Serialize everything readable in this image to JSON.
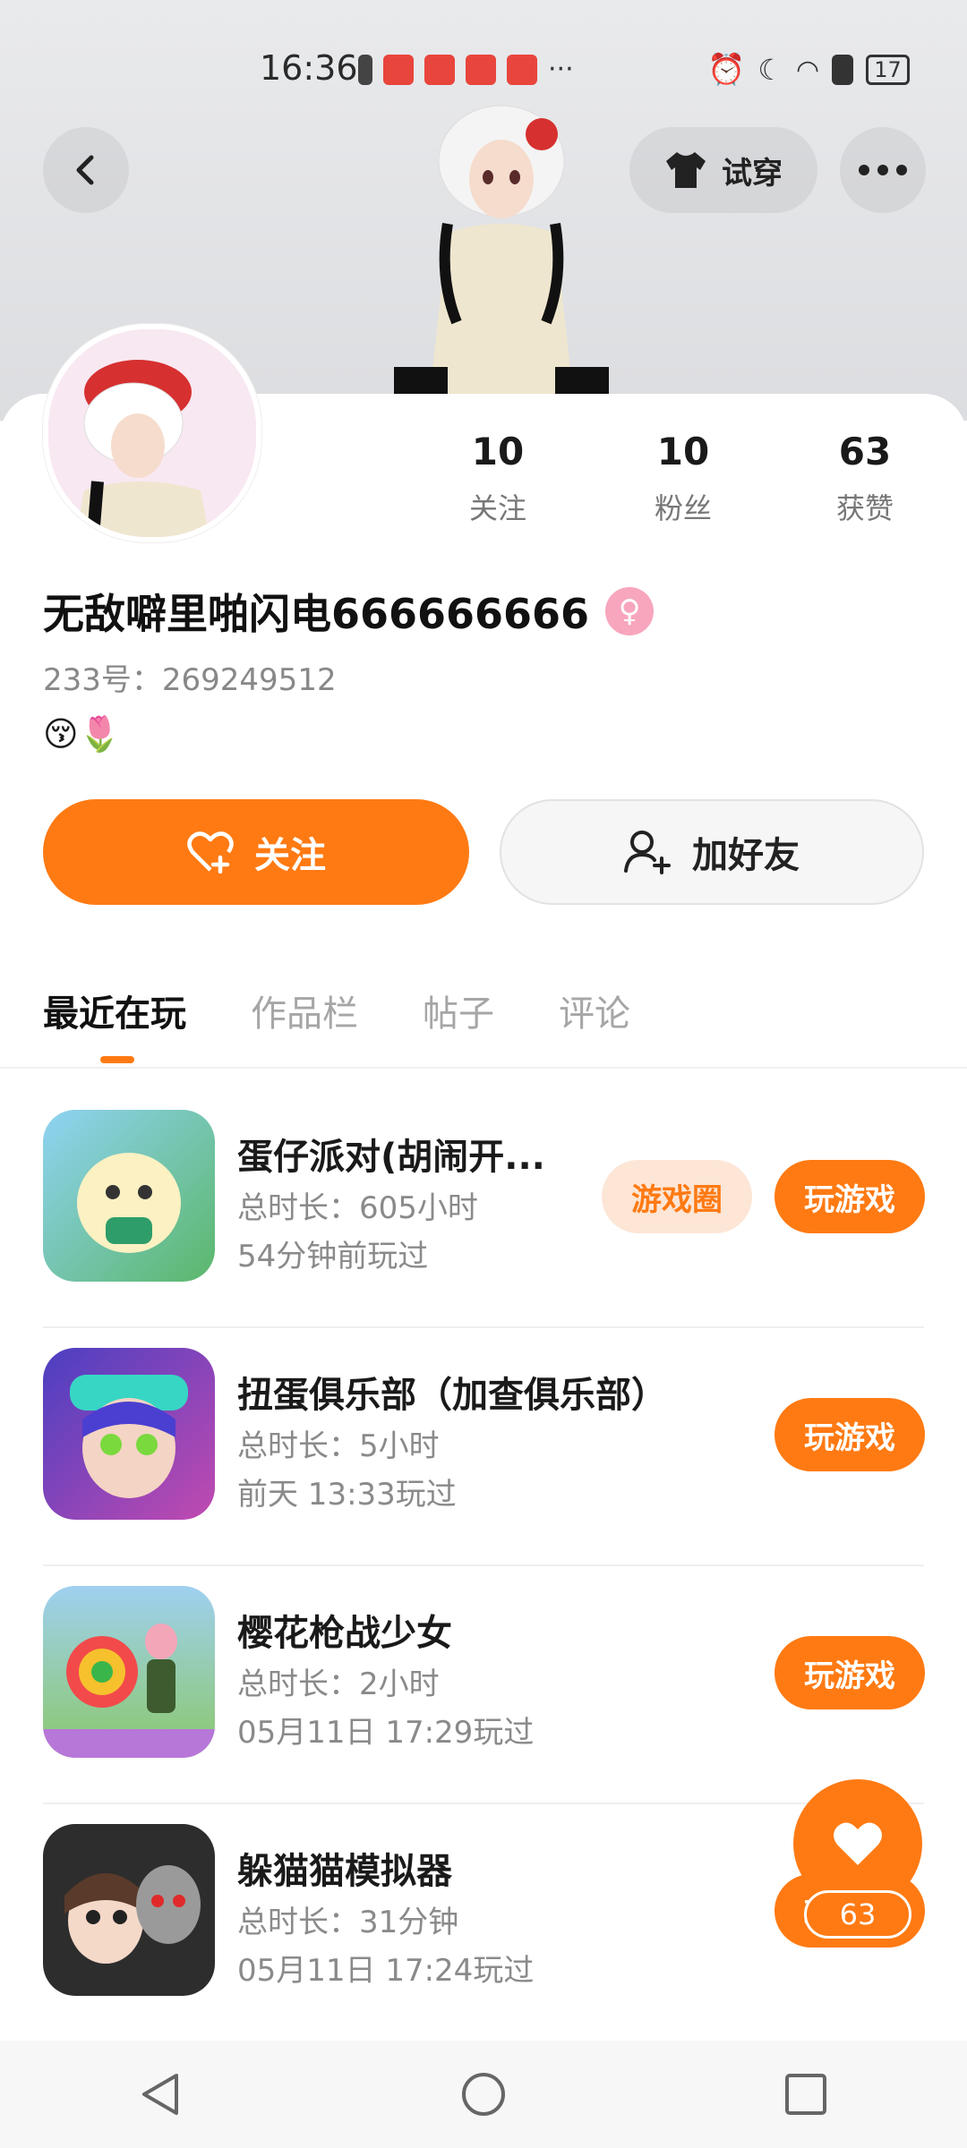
{
  "status_bar": {
    "time": "16:36",
    "battery": "17"
  },
  "header": {
    "try_on_label": "试穿"
  },
  "profile": {
    "stats": [
      {
        "value": "10",
        "label": "关注"
      },
      {
        "value": "10",
        "label": "粉丝"
      },
      {
        "value": "63",
        "label": "获赞"
      }
    ],
    "username": "无敌噼里啪闪电666666666",
    "uid": "233号：269249512",
    "bio_emoji": "😚🌷",
    "follow_label": "关注",
    "add_friend_label": "加好友"
  },
  "tabs": [
    "最近在玩",
    "作品栏",
    "帖子",
    "评论"
  ],
  "games": [
    {
      "title": "蛋仔派对(胡闹开...",
      "duration": "总时长：605小时",
      "last_played": "54分钟前玩过",
      "circle_label": "游戏圈",
      "play_label": "玩游戏",
      "icon_color": "#8fd3f4"
    },
    {
      "title": "扭蛋俱乐部（加查俱乐部）",
      "duration": "总时长：5小时",
      "last_played": "前天 13:33玩过",
      "play_label": "玩游戏",
      "icon_color": "#6c4ad1"
    },
    {
      "title": "樱花枪战少女",
      "duration": "总时长：2小时",
      "last_played": "05月11日 17:29玩过",
      "play_label": "玩游戏",
      "icon_color": "#9bd36a"
    },
    {
      "title": "躲猫猫模拟器",
      "duration": "总时长：31分钟",
      "last_played": "05月11日 17:24玩过",
      "play_label": "玩游戏",
      "icon_color": "#3b3b3b"
    }
  ],
  "like_fab": {
    "count": "63"
  },
  "colors": {
    "accent": "#ff7a13",
    "accent_light": "#fde6d6"
  }
}
